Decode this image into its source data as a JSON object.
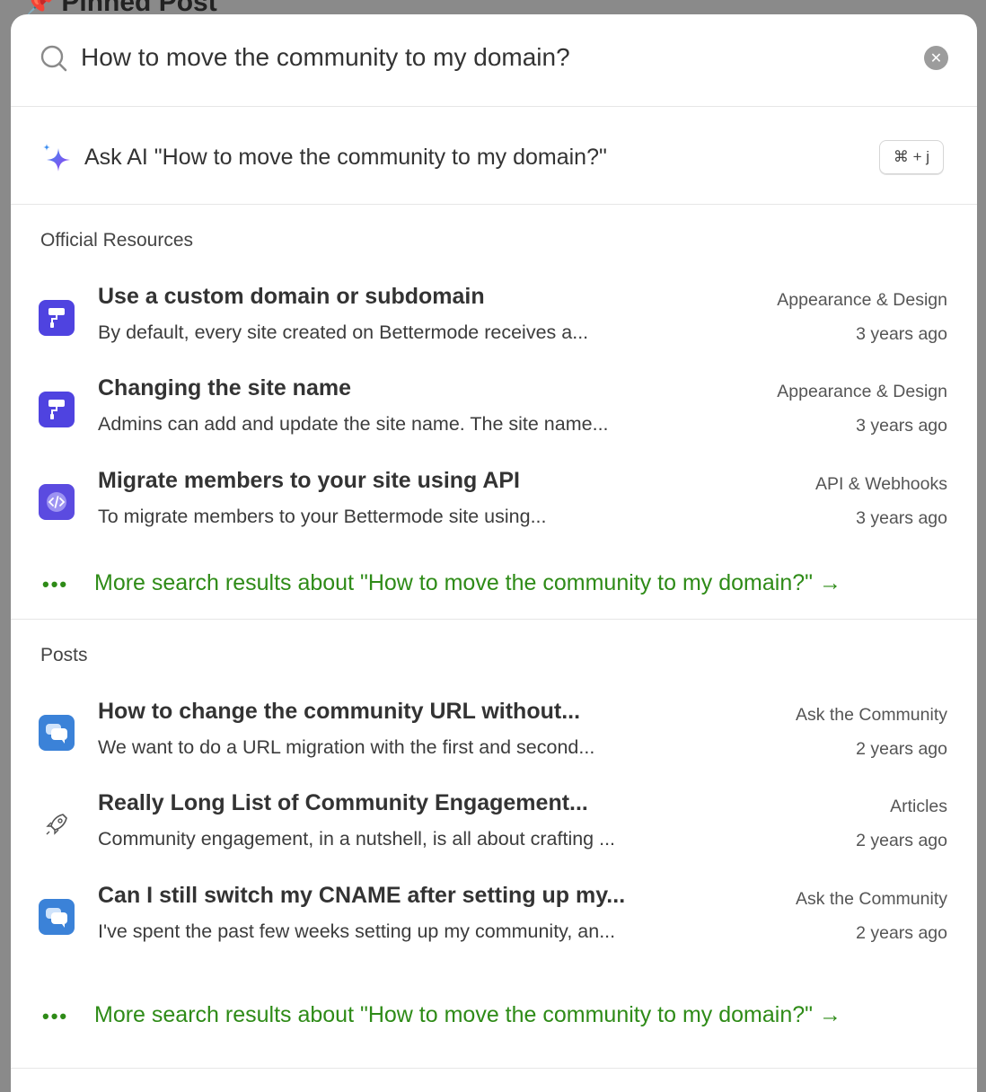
{
  "background": {
    "title": "Pinned Post"
  },
  "search": {
    "value": "How to move the community to my domain?",
    "clear_icon": "close-icon"
  },
  "ask_ai": {
    "label": "Ask AI \"How to move the community to my domain?\"",
    "shortcut": "⌘ + j"
  },
  "official": {
    "title": "Official Resources",
    "items": [
      {
        "title": "Use a custom domain or subdomain",
        "desc": "By default, every site created on Bettermode receives a...",
        "category": "Appearance & Design",
        "time": "3 years ago",
        "icon": "paint-roller-icon"
      },
      {
        "title": "Changing the site name",
        "desc": "Admins can add and update the site name. The site name...",
        "category": "Appearance & Design",
        "time": "3 years ago",
        "icon": "paint-roller-icon"
      },
      {
        "title": "Migrate members to your site using API",
        "desc": "To migrate members to your Bettermode site using...",
        "category": "API & Webhooks",
        "time": "3 years ago",
        "icon": "code-icon"
      }
    ],
    "more": "More search results about \"How to move the community to my domain?\" →"
  },
  "posts": {
    "title": "Posts",
    "items": [
      {
        "title": "How to change the community URL without...",
        "desc": "We want to do a URL migration with the first and second...",
        "category": "Ask the Community",
        "time": "2 years ago",
        "icon": "chat-bubbles-icon"
      },
      {
        "title": "Really Long List of Community Engagement...",
        "desc": "Community engagement, in a nutshell, is all about crafting ...",
        "category": "Articles",
        "time": "2 years ago",
        "icon": "rocket-icon"
      },
      {
        "title": "Can I still switch my CNAME after setting up my...",
        "desc": "I've spent the past few weeks setting up my community, an...",
        "category": "Ask the Community",
        "time": "2 years ago",
        "icon": "chat-bubbles-icon"
      }
    ],
    "more": "More search results about \"How to move the community to my domain?\" →"
  },
  "colors": {
    "accent_green": "#2e8b17",
    "icon_blue": "#4f43e0",
    "chat_blue": "#3b82d8"
  }
}
